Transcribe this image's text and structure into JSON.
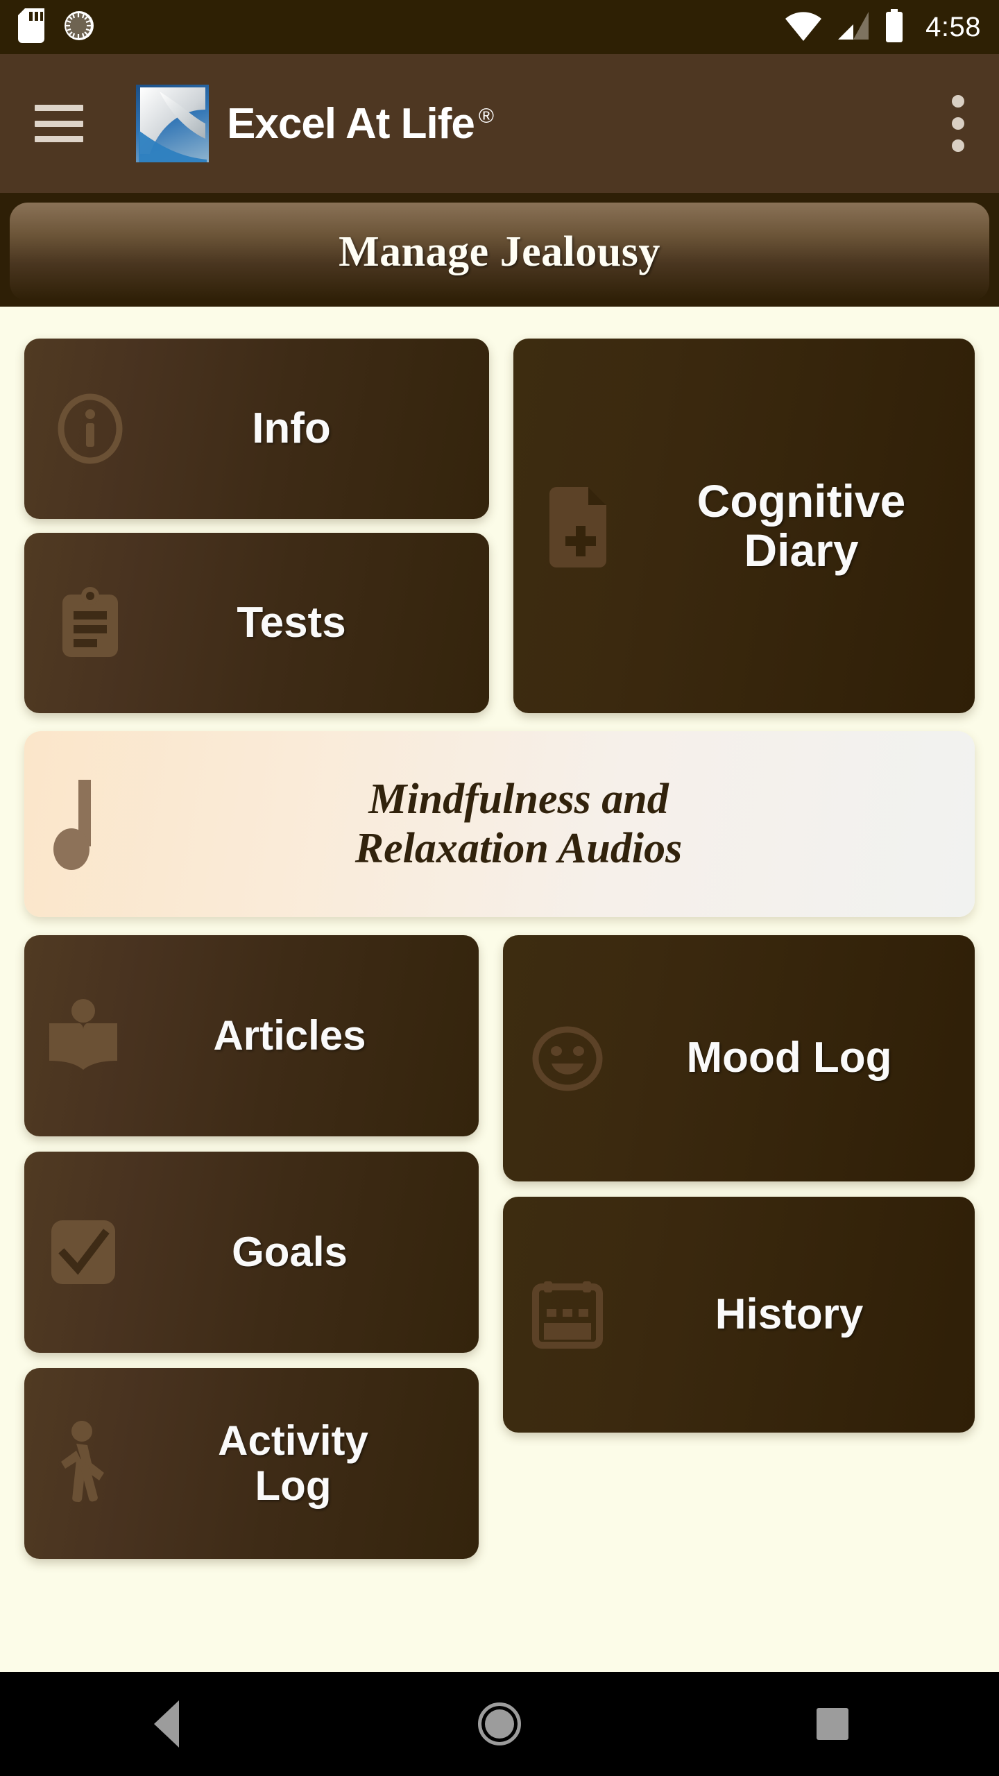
{
  "status_bar": {
    "time": "4:58",
    "icons_left": [
      "sd-card-icon",
      "sync-progress-icon"
    ],
    "icons_right": [
      "wifi-icon",
      "cellular-signal-icon",
      "battery-icon"
    ],
    "background_color": "#2E2004"
  },
  "app_bar": {
    "menu_icon": "hamburger-menu-icon",
    "logo_icon": "excel-at-life-logo",
    "title": "Excel At Life",
    "trademark": "®",
    "overflow_icon": "kebab-overflow-icon",
    "background_color": "#4E3722"
  },
  "banner": {
    "title": "Manage Jealousy",
    "background_color": "#2E1F06"
  },
  "page": {
    "background_color": "#FCFCE8",
    "card_color_dark": "#493320",
    "card_color_darker": "#35240B",
    "accent_cream": "#FBE6CA",
    "text_color": "#FAFAFA"
  },
  "cards": [
    {
      "id": "info",
      "label": "Info",
      "icon": "info-circle-icon"
    },
    {
      "id": "tests",
      "label": "Tests",
      "icon": "clipboard-list-icon"
    },
    {
      "id": "diary",
      "label": "Cognitive\nDiary",
      "line1": "Cognitive",
      "line2": "Diary",
      "icon": "note-add-icon"
    },
    {
      "id": "audio",
      "line1": "Mindfulness and",
      "line2": "Relaxation Audios",
      "icon": "music-note-icon"
    },
    {
      "id": "articles",
      "label": "Articles",
      "icon": "book-open-icon"
    },
    {
      "id": "goals",
      "label": "Goals",
      "icon": "check-box-icon"
    },
    {
      "id": "activity",
      "line1": "Activity",
      "line2": "Log",
      "icon": "walking-person-icon"
    },
    {
      "id": "mood",
      "label": "Mood Log",
      "icon": "smiley-face-icon"
    },
    {
      "id": "history",
      "label": "History",
      "icon": "calendar-icon"
    }
  ],
  "nav_bar": {
    "back_label": "back-button",
    "home_label": "home-button",
    "recents_label": "recents-button",
    "background_color": "#000000"
  }
}
